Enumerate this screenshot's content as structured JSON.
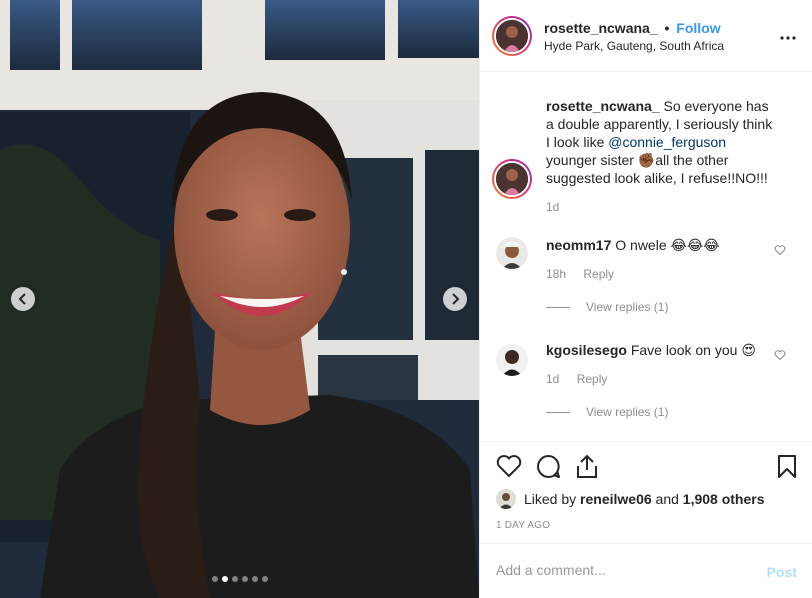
{
  "post": {
    "username": "rosette_ncwana_",
    "separator": "•",
    "follow_label": "Follow",
    "location": "Hyde Park, Gauteng, South Africa",
    "photo_alt": "Selfie of a smiling woman with a ponytail in a black top",
    "carousel_total": 6,
    "carousel_active": 2
  },
  "caption": {
    "username": "rosette_ncwana_",
    "text_before": "So everyone has a double apparently, I seriously think I look like",
    "mention": "@connie_ferguson",
    "text_after": "younger sister ✊🏾all the other suggested look alike, I refuse!!NO!!!",
    "time": "1d"
  },
  "comments": [
    {
      "username": "neomm17",
      "text": "O nwele 😂😂😂",
      "time": "18h",
      "reply_label": "Reply",
      "view_replies": "View replies (1)"
    },
    {
      "username": "kgosilesego",
      "text": "Fave look on you 😍",
      "time": "1d",
      "reply_label": "Reply",
      "view_replies": "View replies (1)"
    }
  ],
  "likes": {
    "prefix": "Liked by",
    "user": "reneilwe06",
    "and": "and",
    "others": "1,908 others"
  },
  "time_ago": "1 DAY AGO",
  "add_comment": {
    "placeholder": "Add a comment...",
    "post_label": "Post"
  },
  "colors": {
    "link_blue": "#3897f0",
    "post_disabled": "#b2dffc",
    "muted": "#8e8e8e",
    "border": "#efefef"
  }
}
